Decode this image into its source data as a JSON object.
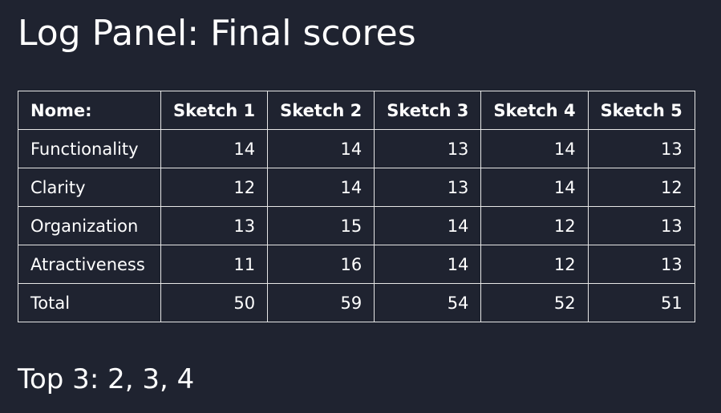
{
  "page": {
    "title": "Log Panel: Final scores",
    "top3": "Top 3: 2, 3, 4"
  },
  "table": {
    "headers": [
      "Nome:",
      "Sketch 1",
      "Sketch 2",
      "Sketch 3",
      "Sketch 4",
      "Sketch 5"
    ],
    "rows": [
      {
        "label": "Functionality",
        "values": [
          "14",
          "14",
          "13",
          "14",
          "13"
        ]
      },
      {
        "label": "Clarity",
        "values": [
          "12",
          "14",
          "13",
          "14",
          "12"
        ]
      },
      {
        "label": "Organization",
        "values": [
          "13",
          "15",
          "14",
          "12",
          "13"
        ]
      },
      {
        "label": "Atractiveness",
        "values": [
          "11",
          "16",
          "14",
          "12",
          "13"
        ]
      },
      {
        "label": "Total",
        "values": [
          "50",
          "59",
          "54",
          "52",
          "51"
        ]
      }
    ]
  },
  "colors": {
    "background": "#1f2330",
    "text": "#ffffff",
    "border": "#e6e6e6"
  }
}
